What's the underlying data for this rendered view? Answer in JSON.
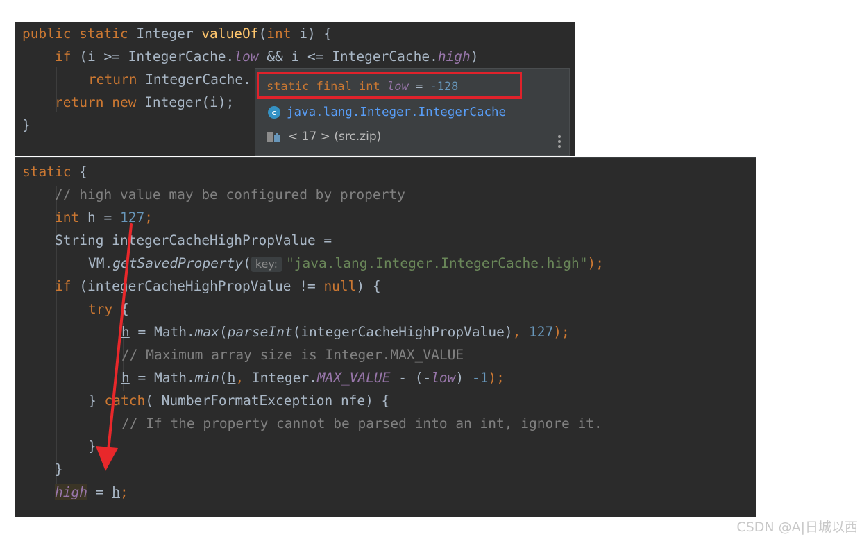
{
  "top_snippet": {
    "line1": {
      "kw1": "public static ",
      "type": "Integer ",
      "name": "valueOf",
      "lp": "(",
      "kw2": "int",
      "rest": " i) {"
    },
    "line2": {
      "kw": "if",
      "a": " (i >= IntegerCache.",
      "f1": "low",
      "b": " && i <= IntegerCache.",
      "f2": "high",
      "c": ")"
    },
    "line3": {
      "kw": "return",
      "text": " IntegerCache."
    },
    "line4": {
      "kw1": "return",
      "sp": " ",
      "kw2": "new",
      "rest": " Integer(i);"
    },
    "line5": {
      "text": "}"
    }
  },
  "popup": {
    "decl_kw": "static final int ",
    "decl_field": "low",
    "decl_eq": " = ",
    "decl_value": "-128",
    "class_icon_letter": "c",
    "class_name": "java.lang.Integer.IntegerCache",
    "library": "< 17 > (src.zip)"
  },
  "bottom_snippet": {
    "l1": {
      "kw": "static",
      "rest": " {"
    },
    "l2": {
      "comment": "// high value may be configured by property"
    },
    "l3": {
      "kw": "int",
      "sp": " ",
      "var": "h",
      "eq": " = ",
      "num": "127",
      "semi": ";"
    },
    "l4": {
      "text": "String integerCacheHighPropValue ="
    },
    "l5": {
      "a": "VM.",
      "m": "getSavedProperty",
      "lp": "(",
      "hint": "key:",
      "str": "\"java.lang.Integer.IntegerCache.high\"",
      "end": ");"
    },
    "l6": {
      "kw1": "if",
      "a": " (integerCacheHighPropValue != ",
      "kw2": "null",
      "b": ") {"
    },
    "l7": {
      "kw": "try",
      "rest": " {"
    },
    "l8": {
      "var": "h",
      "a": " = Math.",
      "m1": "max",
      "b": "(",
      "m2": "parseInt",
      "c": "(integerCacheHighPropValue)",
      "comma": ", ",
      "num": "127",
      "end": ");"
    },
    "l9": {
      "comment": "// Maximum array size is Integer.MAX_VALUE"
    },
    "l10": {
      "var": "h",
      "a": " = Math.",
      "m": "min",
      "b": "(",
      "var2": "h",
      "comma": ", ",
      "c": "Integer.",
      "f": "MAX_VALUE",
      "d": " - (-",
      "f2": "low",
      "e": ") ",
      "num": "-1",
      "end": ");"
    },
    "l11": {
      "a": "} ",
      "kw": "catch",
      "b": "( NumberFormatException nfe) {"
    },
    "l12": {
      "comment": "// If the property cannot be parsed into an int, ignore it."
    },
    "l13": {
      "text": "}"
    },
    "l14": {
      "text": "}"
    },
    "l15": {
      "field": "high",
      "eq": " = ",
      "var": "h",
      "semi": ";"
    }
  },
  "watermark": "CSDN @A|日城以西",
  "colors": {
    "editor_bg": "#2b2b2b",
    "keyword": "#cc7832",
    "number": "#6897bb",
    "string": "#6a8759",
    "field": "#9876aa",
    "comment": "#808080",
    "highlight_box": "#e0222b",
    "arrow": "#e8282b"
  }
}
